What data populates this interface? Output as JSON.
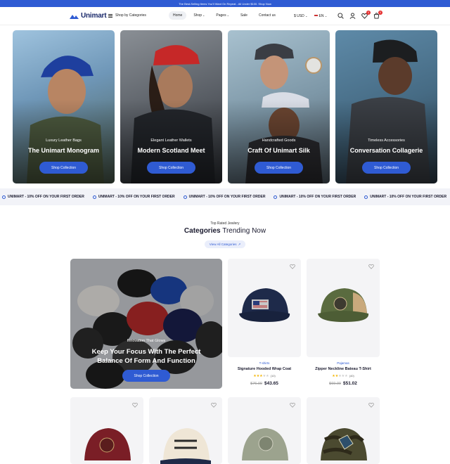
{
  "announcement": "The Best-Selling Items You'll Want On Repeat - All Under $100. Shop Now",
  "header": {
    "logo": "Unimart",
    "categories_label": "Shop by Categories",
    "nav": [
      {
        "label": "Home",
        "active": true,
        "dropdown": false
      },
      {
        "label": "Shop",
        "active": false,
        "dropdown": true
      },
      {
        "label": "Pages",
        "active": false,
        "dropdown": true
      },
      {
        "label": "Sale",
        "active": false,
        "dropdown": false
      },
      {
        "label": "Contact us",
        "active": false,
        "dropdown": false
      }
    ],
    "currency": "$ USD",
    "language": "EN",
    "wishlist_count": "0",
    "cart_count": "0"
  },
  "banners": [
    {
      "subtitle": "Luxury Leather Bags",
      "title": "The Unimart Monogram",
      "button": "Shop Collection"
    },
    {
      "subtitle": "Elegant Leather Wallets",
      "title": "Modern Scotland Meet",
      "button": "Shop Collection"
    },
    {
      "subtitle": "Handcrafted Goods",
      "title": "Craft Of Unimart Silk",
      "button": "Shop Collection"
    },
    {
      "subtitle": "Timeless Accessories",
      "title": "Conversation Collagerie",
      "button": "Shop Collection"
    }
  ],
  "ticker": [
    "UNIMART - 10% OFF ON YOUR FIRST ORDER",
    "UNIMART - 10% OFF ON YOUR FIRST ORDER",
    "UNIMART - 10% OFF ON YOUR FIRST ORDER",
    "UNIMART - 10% OFF ON YOUR FIRST ORDER",
    "UNIMART - 10% OFF ON YOUR FIRST ORDER"
  ],
  "section": {
    "kicker": "Top Rated Jewlery",
    "title_bold": "Categories",
    "title_rest": "Trending Now",
    "view_all": "View All Categories"
  },
  "feature": {
    "subtitle": "Innovation That Glows",
    "title": "Keep Your Focus With The Perfect Balance Of Form And Function",
    "button": "Shop Collection"
  },
  "products": [
    {
      "category": "T-shirts",
      "name": "Signature Hooded Wrap Coat",
      "rating": 3,
      "reviews": "(10)",
      "old_price": "$76.00",
      "price": "$43.65"
    },
    {
      "category": "Pajamas",
      "name": "Zipper Neckline Bateau T-Shirt",
      "rating": 2,
      "reviews": "(40)",
      "old_price": "$69.00",
      "price": "$51.02"
    }
  ],
  "colors": {
    "accent": "#2f5bd3",
    "badge": "#e52d2d"
  },
  "icons": [
    "search-icon",
    "user-icon",
    "heart-icon",
    "cart-icon",
    "arrow-up-right-icon"
  ]
}
